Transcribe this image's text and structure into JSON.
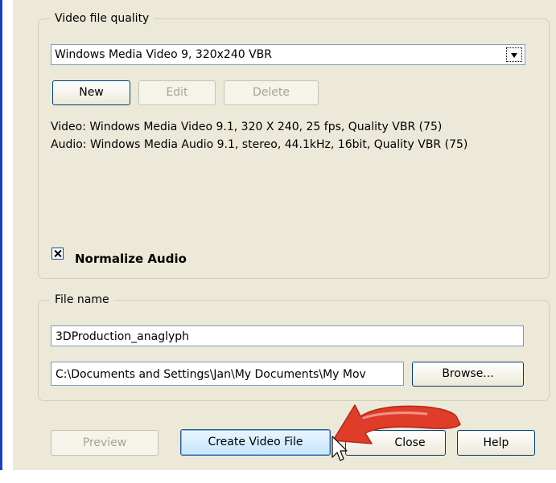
{
  "colors": {
    "accent_line": "#1a42b8",
    "dialog_background": "#ece9d8",
    "arrow_red": "#e03c2a"
  },
  "video_quality": {
    "group_label": "Video file quality",
    "selected_profile": "Windows Media Video 9, 320x240 VBR",
    "buttons": {
      "new": "New",
      "edit": "Edit",
      "delete": "Delete"
    },
    "video_info": "Video: Windows Media Video 9.1, 320 X 240, 25 fps, Quality VBR (75)",
    "audio_info": "Audio: Windows Media Audio 9.1, stereo, 44.1kHz, 16bit, Quality VBR (75)",
    "normalize_audio": {
      "label": "Normalize Audio",
      "checked": true
    }
  },
  "file_name": {
    "group_label": "File name",
    "name_value": "3DProduction_anaglyph",
    "path_value": "C:\\Documents and Settings\\Jan\\My Documents\\My Mov",
    "browse_label": "Browse..."
  },
  "footer": {
    "preview_label": "Preview",
    "create_label": "Create Video File",
    "close_label": "Close",
    "help_label": "Help"
  },
  "annotation": {
    "arrow": "red-curved-arrow",
    "cursor": "mouse-pointer-icon"
  }
}
